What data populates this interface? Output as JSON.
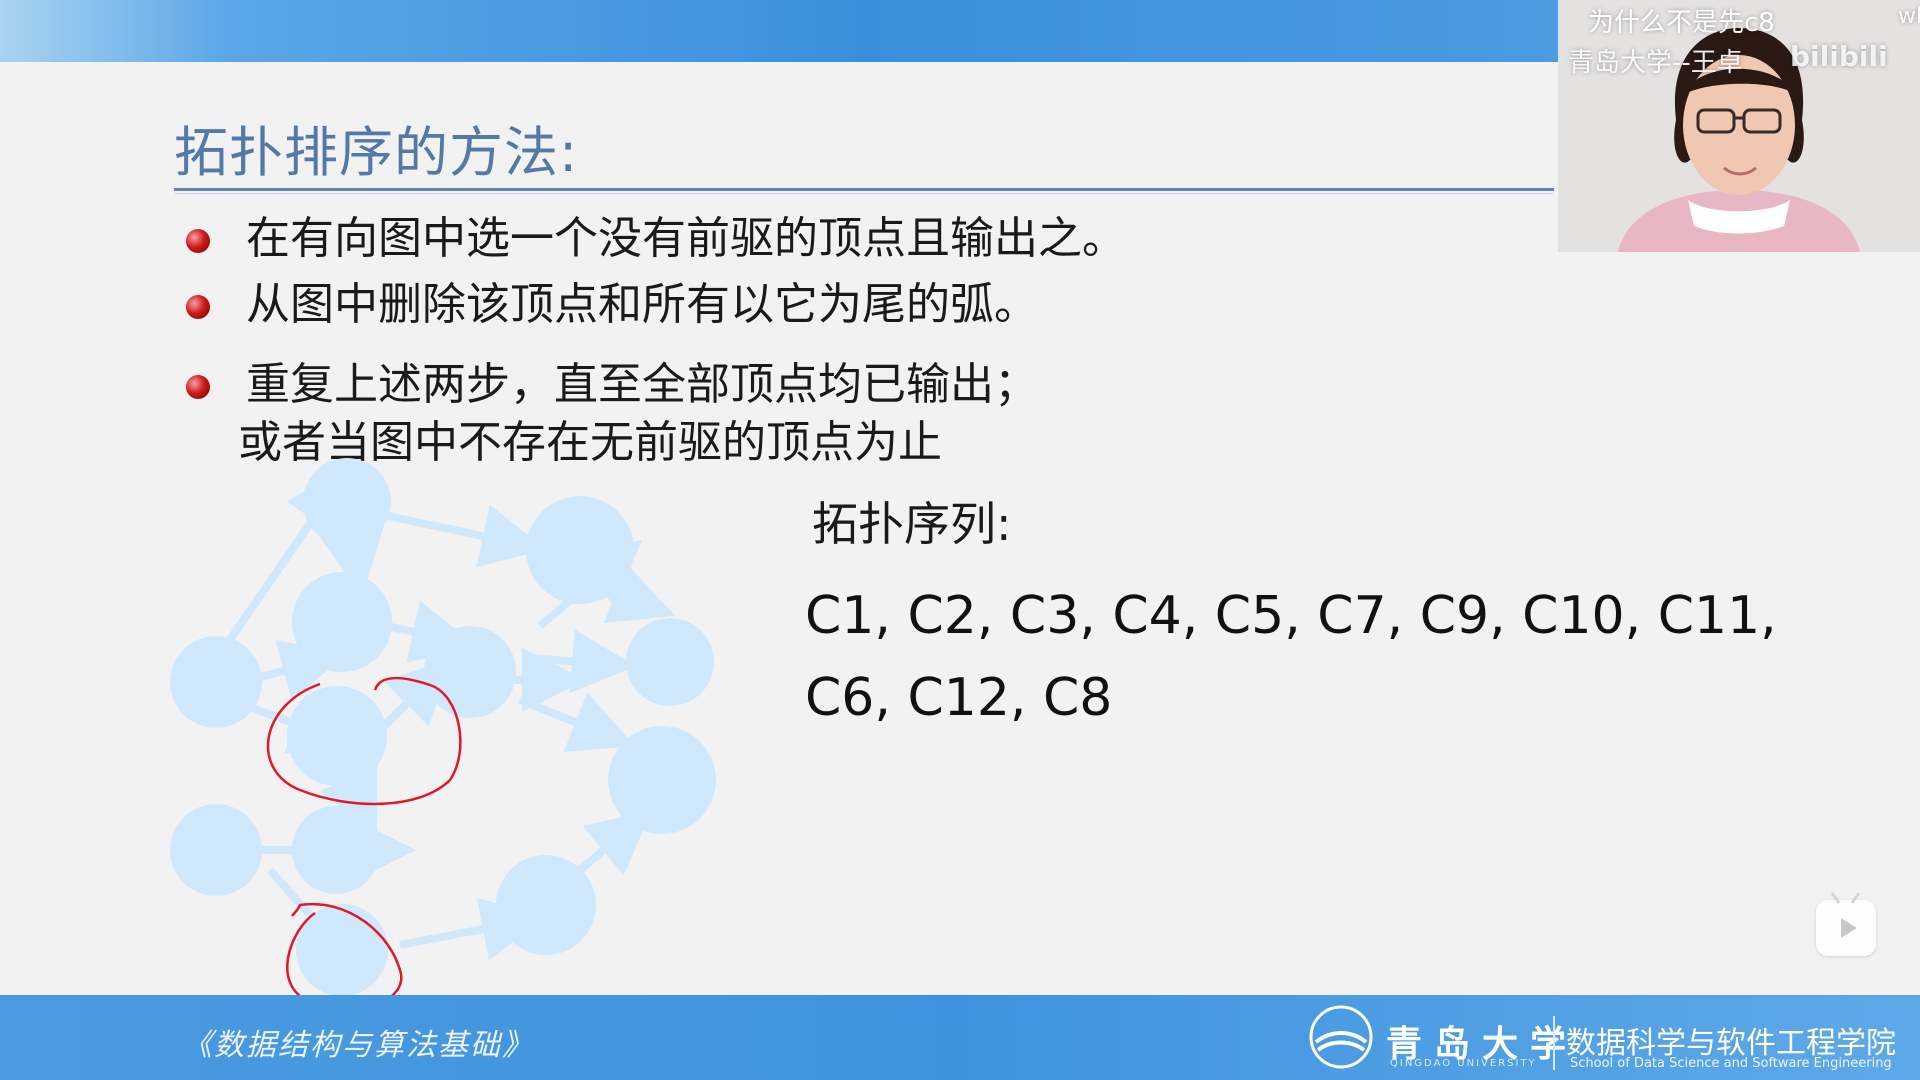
{
  "slide": {
    "title": "拓扑排序的方法:",
    "bullets": [
      "在有向图中选一个没有前驱的顶点且输出之。",
      "从图中删除该顶点和所有以它为尾的弧。",
      "重复上述两步，直至全部顶点均已输出；",
      "或者当图中不存在无前驱的顶点为止"
    ],
    "sequence_label": "拓扑序列:",
    "sequence_line1": "C1, C2, C3, C4, C5, C7, C9, C10,  C11,",
    "sequence_line2": "C6, C12, C8"
  },
  "webcam": {
    "caption_danmaku": "为什么不是先c8",
    "caption_edge": "wh",
    "caption_watermark": "青岛大学--王卓",
    "platform_logo": "bilibili"
  },
  "footer": {
    "book_title": "《数据结构与算法基础》",
    "university_name": "青岛大学",
    "university_en": "QINGDAO UNIVERSITY",
    "school_zh": "数据科学与软件工程学院",
    "school_en": "School of Data Science and Software Engineering"
  },
  "colors": {
    "node_fill": "#cfe8fb",
    "annotation_ink": "#e0182a",
    "title_color": "#5279a8",
    "bar_blue": "#3f93de"
  },
  "icons": {
    "play_button": "play-icon",
    "bullet": "red-ball-bullet"
  }
}
